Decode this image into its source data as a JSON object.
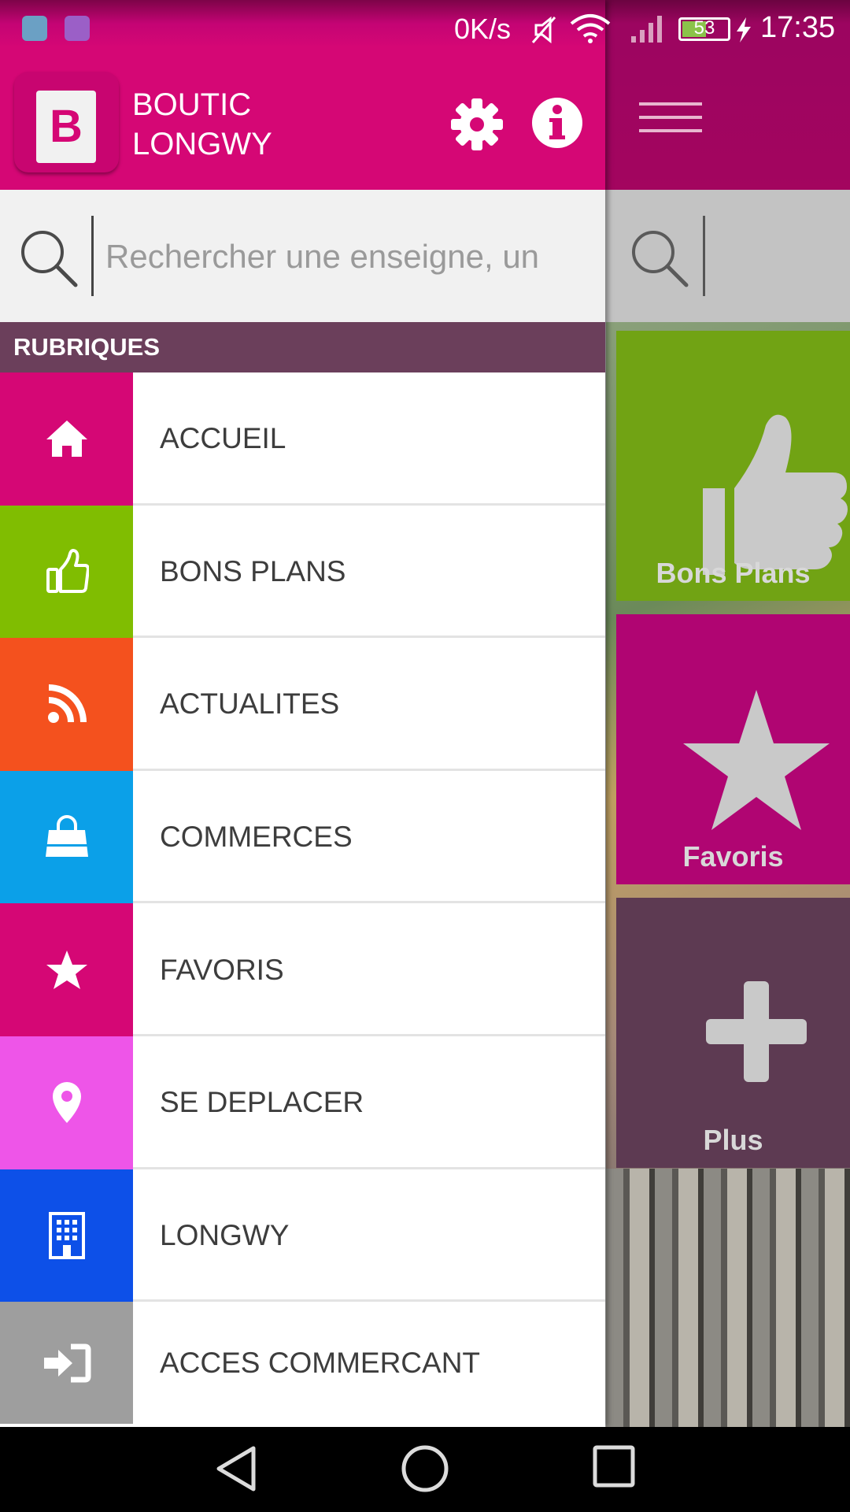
{
  "status_bar": {
    "net_speed": "0K/s",
    "battery_level": "53",
    "time": "17:35"
  },
  "header": {
    "title_line1": "BOUTIC",
    "title_line2": "LONGWY",
    "logo_letter": "B"
  },
  "search": {
    "placeholder": "Rechercher une enseigne, un"
  },
  "section": {
    "title": "RUBRIQUES"
  },
  "menu": {
    "items": [
      {
        "label": "ACCUEIL",
        "icon": "home-icon",
        "color": "#d50775"
      },
      {
        "label": "BONS PLANS",
        "icon": "thumbs-up-icon",
        "color": "#80bd01"
      },
      {
        "label": "ACTUALITES",
        "icon": "rss-icon",
        "color": "#f4511e"
      },
      {
        "label": "COMMERCES",
        "icon": "shopping-bag-icon",
        "color": "#0ba0e8"
      },
      {
        "label": "FAVORIS",
        "icon": "star-icon",
        "color": "#d50775"
      },
      {
        "label": "SE DEPLACER",
        "icon": "map-pin-icon",
        "color": "#ee55e8"
      },
      {
        "label": "LONGWY",
        "icon": "building-icon",
        "color": "#0d50e8"
      },
      {
        "label": "ACCES COMMERCANT",
        "icon": "sign-in-icon",
        "color": "#9e9e9e"
      }
    ]
  },
  "background_tiles": {
    "bons_plans": "Bons Plans",
    "favoris": "Favoris",
    "plus": "Plus"
  },
  "colors": {
    "brand": "#d50775",
    "section_header": "#6b3f5b"
  }
}
